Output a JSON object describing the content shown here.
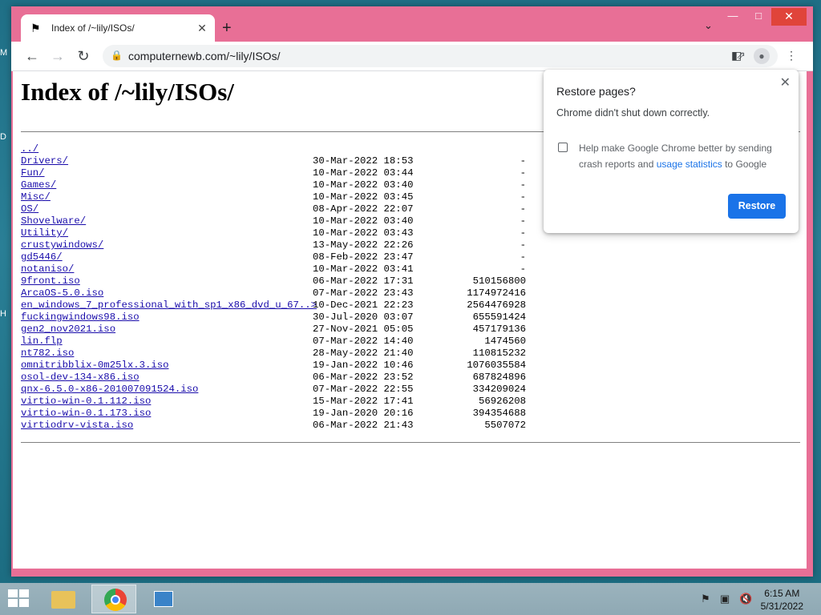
{
  "browser": {
    "tab_title": "Index of /~lily/ISOs/",
    "url": "computernewb.com/~lily/ISOs/"
  },
  "page": {
    "heading": "Index of /~lily/ISOs/",
    "entries": [
      {
        "name": "../",
        "date": "",
        "size": ""
      },
      {
        "name": "Drivers/",
        "date": "30-Mar-2022 18:53",
        "size": "-"
      },
      {
        "name": "Fun/",
        "date": "10-Mar-2022 03:44",
        "size": "-"
      },
      {
        "name": "Games/",
        "date": "10-Mar-2022 03:40",
        "size": "-"
      },
      {
        "name": "Misc/",
        "date": "10-Mar-2022 03:45",
        "size": "-"
      },
      {
        "name": "OS/",
        "date": "08-Apr-2022 22:07",
        "size": "-"
      },
      {
        "name": "Shovelware/",
        "date": "10-Mar-2022 03:40",
        "size": "-"
      },
      {
        "name": "Utility/",
        "date": "10-Mar-2022 03:43",
        "size": "-"
      },
      {
        "name": "crustywindows/",
        "date": "13-May-2022 22:26",
        "size": "-"
      },
      {
        "name": "gd5446/",
        "date": "08-Feb-2022 23:47",
        "size": "-"
      },
      {
        "name": "notaniso/",
        "date": "10-Mar-2022 03:41",
        "size": "-"
      },
      {
        "name": "9front.iso",
        "date": "06-Mar-2022 17:31",
        "size": "510156800"
      },
      {
        "name": "ArcaOS-5.0.iso",
        "date": "07-Mar-2022 23:43",
        "size": "1174972416"
      },
      {
        "name": "en_windows_7_professional_with_sp1_x86_dvd_u_67..>",
        "date": "10-Dec-2021 22:23",
        "size": "2564476928"
      },
      {
        "name": "fuckingwindows98.iso",
        "date": "30-Jul-2020 03:07",
        "size": "655591424"
      },
      {
        "name": "gen2_nov2021.iso",
        "date": "27-Nov-2021 05:05",
        "size": "457179136"
      },
      {
        "name": "lin.flp",
        "date": "07-Mar-2022 14:40",
        "size": "1474560"
      },
      {
        "name": "nt782.iso",
        "date": "28-May-2022 21:40",
        "size": "110815232"
      },
      {
        "name": "omnitribblix-0m25lx.3.iso",
        "date": "19-Jan-2022 10:46",
        "size": "1076035584"
      },
      {
        "name": "osol-dev-134-x86.iso",
        "date": "06-Mar-2022 23:52",
        "size": "687824896"
      },
      {
        "name": "qnx-6.5.0-x86-201007091524.iso",
        "date": "07-Mar-2022 22:55",
        "size": "334209024"
      },
      {
        "name": "virtio-win-0.1.112.iso",
        "date": "15-Mar-2022 17:41",
        "size": "56926208"
      },
      {
        "name": "virtio-win-0.1.173.iso",
        "date": "19-Jan-2020 20:16",
        "size": "394354688"
      },
      {
        "name": "virtiodrv-vista.iso",
        "date": "06-Mar-2022 21:43",
        "size": "5507072"
      }
    ]
  },
  "popup": {
    "title": "Restore pages?",
    "message": "Chrome didn't shut down correctly.",
    "checkbox_text_before": "Help make Google Chrome better by sending crash reports and ",
    "checkbox_link": "usage statistics",
    "checkbox_text_after": " to Google",
    "restore_label": "Restore"
  },
  "taskbar": {
    "time": "6:15 AM",
    "date": "5/31/2022"
  },
  "colors": {
    "window_frame": "#e86f96",
    "link": "#1a0dab",
    "accent": "#1a73e8"
  }
}
